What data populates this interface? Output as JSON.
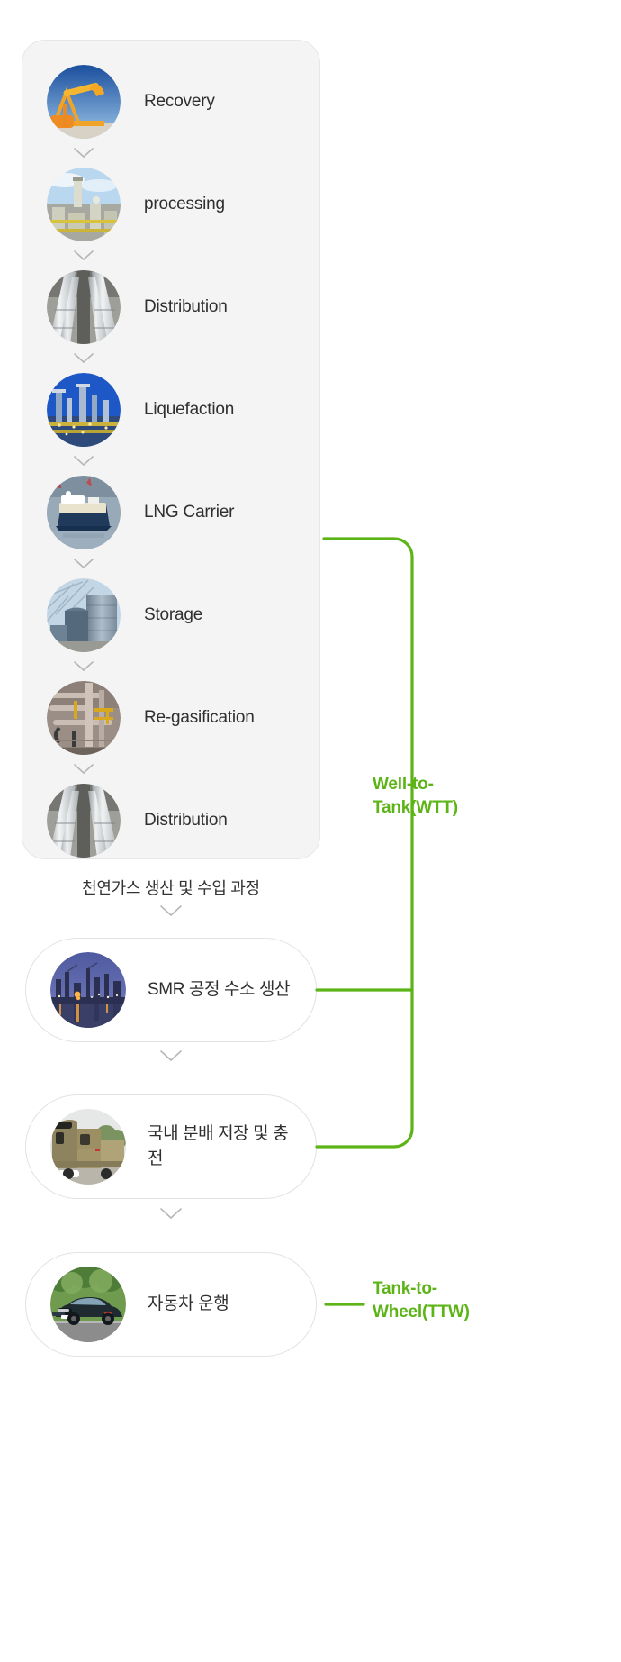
{
  "diagram": {
    "title_hidden": "",
    "accent_green": "#5cb417",
    "card_bg": "#f4f4f4",
    "text_color": "#2f2f2f"
  },
  "wtt_card": {
    "stages": [
      {
        "label": "Recovery",
        "icon": "oil-pumpjack-icon"
      },
      {
        "label": "processing",
        "icon": "gas-processing-plant-icon"
      },
      {
        "label": "Distribution",
        "icon": "pipeline-icon"
      },
      {
        "label": "Liquefaction",
        "icon": "liquefaction-plant-icon"
      },
      {
        "label": "LNG Carrier",
        "icon": "lng-ship-icon"
      },
      {
        "label": "Storage",
        "icon": "storage-tank-icon"
      },
      {
        "label": "Re-gasification",
        "icon": "regasification-pipes-icon"
      },
      {
        "label": "Distribution",
        "icon": "pipeline-icon"
      }
    ]
  },
  "caption": {
    "text": "천연가스 생산 및 수입 과정"
  },
  "pills": [
    {
      "label": "SMR 공정 수소 생산",
      "icon": "refinery-night-icon"
    },
    {
      "label": "국내 분배 저장 및 충전",
      "icon": "tanker-truck-icon"
    },
    {
      "label": "자동차 운행",
      "icon": "car-icon"
    }
  ],
  "annotations": {
    "wtt": "Well-to-Tank(WTT)",
    "ttw": "Tank-to-Wheel(TTW)"
  },
  "icons": {
    "chevron_down": "chevron-down-icon"
  }
}
